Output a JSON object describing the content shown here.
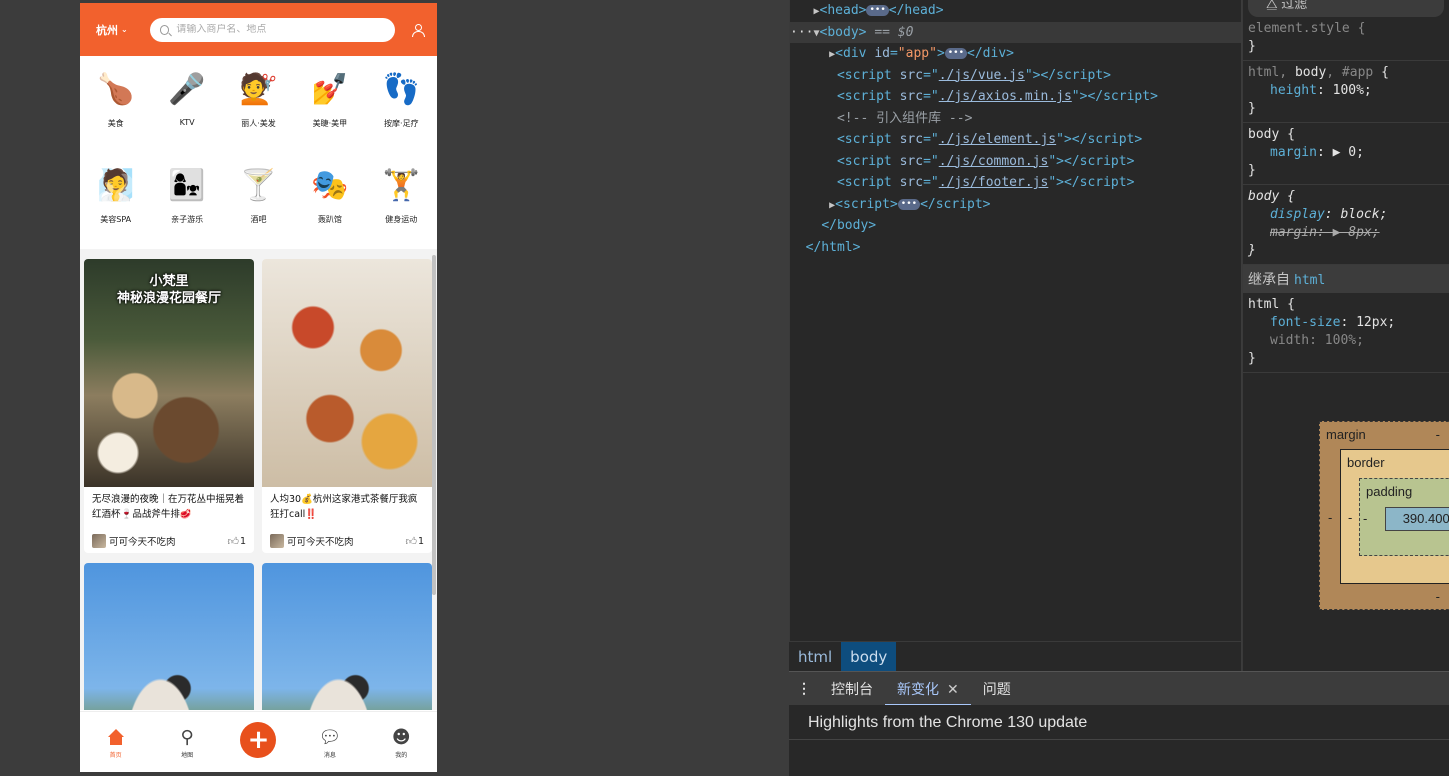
{
  "app": {
    "city": "杭州",
    "search_placeholder": "请输入商户名、地点",
    "categories": [
      {
        "label": "美食",
        "icon": "🍗"
      },
      {
        "label": "KTV",
        "icon": "🎤"
      },
      {
        "label": "丽人·美发",
        "icon": "💇"
      },
      {
        "label": "美睫·美甲",
        "icon": "💅"
      },
      {
        "label": "按摩·足疗",
        "icon": "👣"
      },
      {
        "label": "美容SPA",
        "icon": "🧖"
      },
      {
        "label": "亲子游乐",
        "icon": "👩‍👧"
      },
      {
        "label": "酒吧",
        "icon": "🍸"
      },
      {
        "label": "轰趴馆",
        "icon": "🎭"
      },
      {
        "label": "健身运动",
        "icon": "🏋"
      }
    ],
    "cards": [
      {
        "overlay": "小梵里\n神秘浪漫花园餐厅",
        "title": "无尽浪漫的夜晚｜在万花丛中摇晃着红酒杯🍷品战斧牛排🥩",
        "author": "可可今天不吃肉",
        "likes": "1"
      },
      {
        "overlay": "",
        "title": "人均30💰杭州这家港式茶餐厅我疯狂打call‼️",
        "author": "可可今天不吃肉",
        "likes": "1"
      },
      {
        "overlay": "",
        "title": "",
        "author": "",
        "likes": ""
      },
      {
        "overlay": "",
        "title": "",
        "author": "",
        "likes": ""
      }
    ],
    "tabs": [
      {
        "label": "首页"
      },
      {
        "label": "地图"
      },
      {
        "label": "+"
      },
      {
        "label": "消息"
      },
      {
        "label": "我的"
      }
    ]
  },
  "devtools": {
    "elements": {
      "script_vue": "./js/vue.js",
      "script_axios": "./js/axios.min.js",
      "comment": "<!-- 引入组件库 -->",
      "script_element": "./js/element.js",
      "script_common": "./js/common.js",
      "script_footer": "./js/footer.js",
      "app_id": "app",
      "selected_marker": "== $0"
    },
    "breadcrumbs": [
      "html",
      "body"
    ],
    "drawer_tabs": [
      "控制台",
      "新变化",
      "问题"
    ],
    "drawer_message": "Highlights from the Chrome 130 update",
    "styles": {
      "filter": "过滤",
      "inherited_from": "继承自",
      "inherited_tag": "html",
      "box_model": {
        "margin": "margin",
        "border": "border",
        "padding": "padding",
        "content": "390.400×",
        "dash": "-"
      }
    }
  },
  "colors": {
    "accent": "#f2612d",
    "devtools_bg": "#282828"
  }
}
